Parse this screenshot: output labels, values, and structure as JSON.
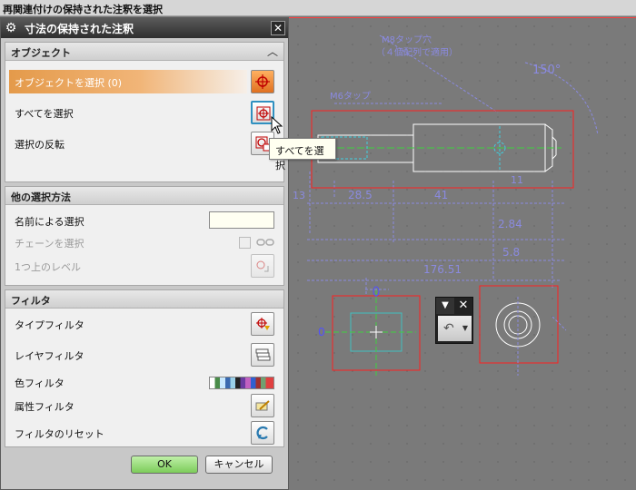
{
  "statusbar": {
    "text": "再関連付けの保持された注釈を選択"
  },
  "dialog": {
    "title": "寸法の保持された注釈",
    "icons": {
      "gear": "gear-icon",
      "close": "close-icon"
    },
    "sections": {
      "object": {
        "label": "オブジェクト",
        "select_object": "オブジェクトを選択 (0)",
        "select_all": "すべてを選択",
        "invert": "選択の反転"
      },
      "other": {
        "label": "他の選択方法",
        "by_name": "名前による選択",
        "chain": "チェーンを選択",
        "level_up": "1つ上のレベル"
      },
      "filter": {
        "label": "フィルタ",
        "type": "タイプフィルタ",
        "layer": "レイヤフィルタ",
        "color": "色フィルタ",
        "attribute": "属性フィルタ",
        "reset": "フィルタのリセット"
      }
    },
    "tooltip": "すべてを選択",
    "ok": "OK",
    "cancel": "キャンセル"
  },
  "canvas": {
    "notes": {
      "thread_top": "M8タップ穴",
      "thread_top2": "（４個配列で適用）",
      "angle": "150°",
      "thread_left": "M6タップ",
      "dim_a": "28.5",
      "dim_b": "41",
      "dim_c": "2.84",
      "dim_d": "5.8",
      "dim_e": "176.51",
      "dim_f": "0",
      "dim_g": "13",
      "dim_h": "11"
    }
  },
  "colors": {
    "accent": "#e49a4a",
    "selection_box": "#ff2020",
    "ok": "#7ccc5a",
    "drawing": "#8a8ae0"
  }
}
